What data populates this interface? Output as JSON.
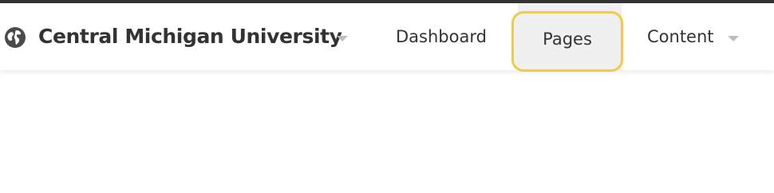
{
  "site": {
    "name": "Central Michigan University",
    "icon": "globe-icon"
  },
  "nav": {
    "dashboard_label": "Dashboard",
    "pages_label": "Pages",
    "content_label": "Content"
  },
  "colors": {
    "top_border": "#333333",
    "focus_ring": "#f2c94c",
    "active_bg": "#f0f0f0",
    "text": "#333333",
    "caret": "#bdbdbd"
  }
}
